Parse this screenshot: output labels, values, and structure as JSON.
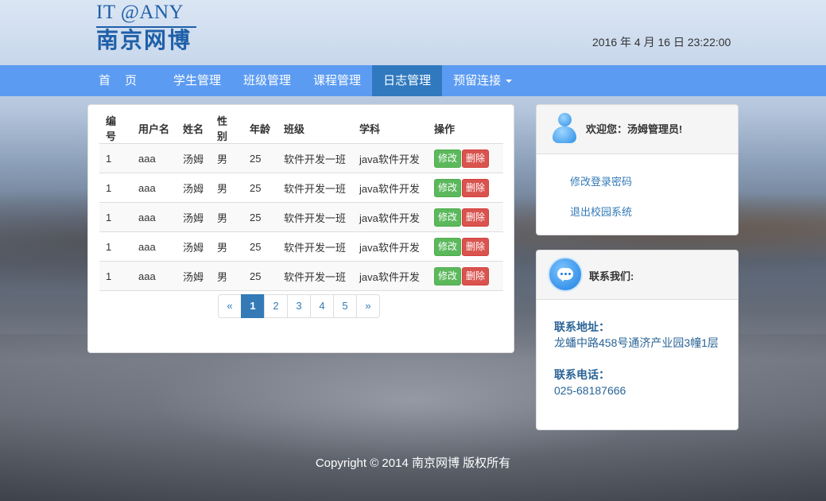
{
  "header": {
    "logo_top": "IT @ANY",
    "logo_bottom": "南京网博",
    "datetime": "2016 年 4 月 16 日 23:22:00"
  },
  "nav": {
    "items": [
      {
        "label": "首页"
      },
      {
        "label": "学生管理"
      },
      {
        "label": "班级管理"
      },
      {
        "label": "课程管理"
      },
      {
        "label": "日志管理"
      },
      {
        "label": "预留连接"
      }
    ],
    "active_index": 4
  },
  "table": {
    "headers": [
      "编号",
      "用户名",
      "姓名",
      "性别",
      "年龄",
      "班级",
      "学科",
      "操作"
    ],
    "rows": [
      {
        "id": "1",
        "username": "aaa",
        "name": "汤姆",
        "gender": "男",
        "age": "25",
        "class": "软件开发一班",
        "subject": "java软件开发"
      },
      {
        "id": "1",
        "username": "aaa",
        "name": "汤姆",
        "gender": "男",
        "age": "25",
        "class": "软件开发一班",
        "subject": "java软件开发"
      },
      {
        "id": "1",
        "username": "aaa",
        "name": "汤姆",
        "gender": "男",
        "age": "25",
        "class": "软件开发一班",
        "subject": "java软件开发"
      },
      {
        "id": "1",
        "username": "aaa",
        "name": "汤姆",
        "gender": "男",
        "age": "25",
        "class": "软件开发一班",
        "subject": "java软件开发"
      },
      {
        "id": "1",
        "username": "aaa",
        "name": "汤姆",
        "gender": "男",
        "age": "25",
        "class": "软件开发一班",
        "subject": "java软件开发"
      }
    ],
    "edit_label": "修改",
    "delete_label": "删除"
  },
  "pagination": {
    "prev": "«",
    "pages": [
      "1",
      "2",
      "3",
      "4",
      "5"
    ],
    "next": "»",
    "current": "1"
  },
  "welcome_panel": {
    "title": "欢迎您：汤姆管理员!",
    "links": [
      "修改登录密码",
      "退出校园系统"
    ]
  },
  "contact_panel": {
    "title": "联系我们:",
    "address_label": "联系地址：",
    "address": "龙蟠中路458号通济产业园3幢1层",
    "phone_label": "联系电话：",
    "phone": "025-68187666"
  },
  "footer": {
    "copyright": "Copyright © 2014 南京网博 版权所有"
  },
  "colors": {
    "navbar": "#5b9bf2",
    "nav_active": "#3079bf",
    "edit_button": "#5cb85c",
    "delete_button": "#d9534f",
    "link": "#337ab7"
  }
}
